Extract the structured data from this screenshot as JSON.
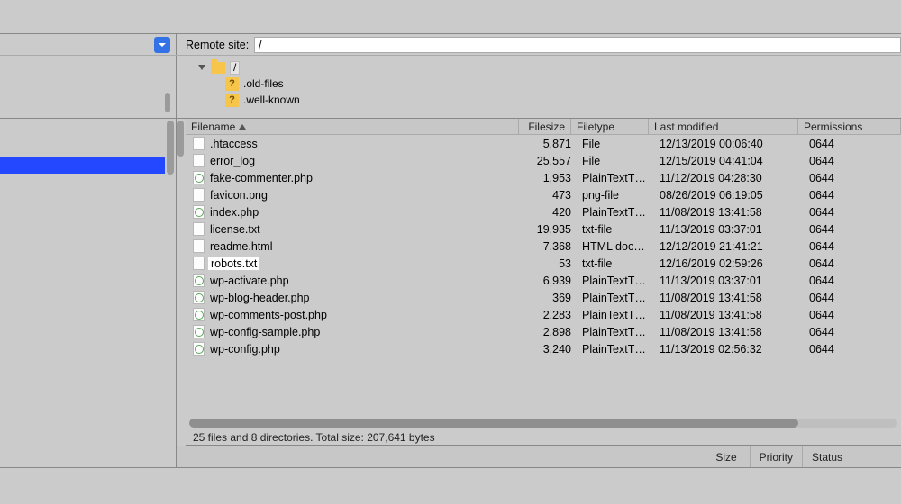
{
  "remote": {
    "label": "Remote site:",
    "path": "/"
  },
  "tree": {
    "root_label": "/",
    "children": [
      {
        "label": ".old-files"
      },
      {
        "label": ".well-known"
      }
    ]
  },
  "columns": {
    "name": "Filename",
    "size": "Filesize",
    "type": "Filetype",
    "modified": "Last modified",
    "permissions": "Permissions"
  },
  "files": [
    {
      "name": ".htaccess",
      "size": "5,871",
      "type": "File",
      "modified": "12/13/2019 00:06:40",
      "perm": "0644",
      "icon": "generic"
    },
    {
      "name": "error_log",
      "size": "25,557",
      "type": "File",
      "modified": "12/15/2019 04:41:04",
      "perm": "0644",
      "icon": "generic"
    },
    {
      "name": "fake-commenter.php",
      "size": "1,953",
      "type": "PlainTextT…",
      "modified": "11/12/2019 04:28:30",
      "perm": "0644",
      "icon": "php"
    },
    {
      "name": "favicon.png",
      "size": "473",
      "type": "png-file",
      "modified": "08/26/2019 06:19:05",
      "perm": "0644",
      "icon": "generic"
    },
    {
      "name": "index.php",
      "size": "420",
      "type": "PlainTextT…",
      "modified": "11/08/2019 13:41:58",
      "perm": "0644",
      "icon": "php"
    },
    {
      "name": "license.txt",
      "size": "19,935",
      "type": "txt-file",
      "modified": "11/13/2019 03:37:01",
      "perm": "0644",
      "icon": "generic"
    },
    {
      "name": "readme.html",
      "size": "7,368",
      "type": "HTML doc…",
      "modified": "12/12/2019 21:41:21",
      "perm": "0644",
      "icon": "generic"
    },
    {
      "name": "robots.txt",
      "size": "53",
      "type": "txt-file",
      "modified": "12/16/2019 02:59:26",
      "perm": "0644",
      "icon": "generic",
      "highlight": true
    },
    {
      "name": "wp-activate.php",
      "size": "6,939",
      "type": "PlainTextT…",
      "modified": "11/13/2019 03:37:01",
      "perm": "0644",
      "icon": "php"
    },
    {
      "name": "wp-blog-header.php",
      "size": "369",
      "type": "PlainTextT…",
      "modified": "11/08/2019 13:41:58",
      "perm": "0644",
      "icon": "php"
    },
    {
      "name": "wp-comments-post.php",
      "size": "2,283",
      "type": "PlainTextT…",
      "modified": "11/08/2019 13:41:58",
      "perm": "0644",
      "icon": "php"
    },
    {
      "name": "wp-config-sample.php",
      "size": "2,898",
      "type": "PlainTextT…",
      "modified": "11/08/2019 13:41:58",
      "perm": "0644",
      "icon": "php"
    },
    {
      "name": "wp-config.php",
      "size": "3,240",
      "type": "PlainTextT…",
      "modified": "11/13/2019 02:56:32",
      "perm": "0644",
      "icon": "php"
    }
  ],
  "status": "25 files and 8 directories. Total size: 207,641 bytes",
  "queue_columns": {
    "size": "Size",
    "priority": "Priority",
    "status": "Status"
  }
}
